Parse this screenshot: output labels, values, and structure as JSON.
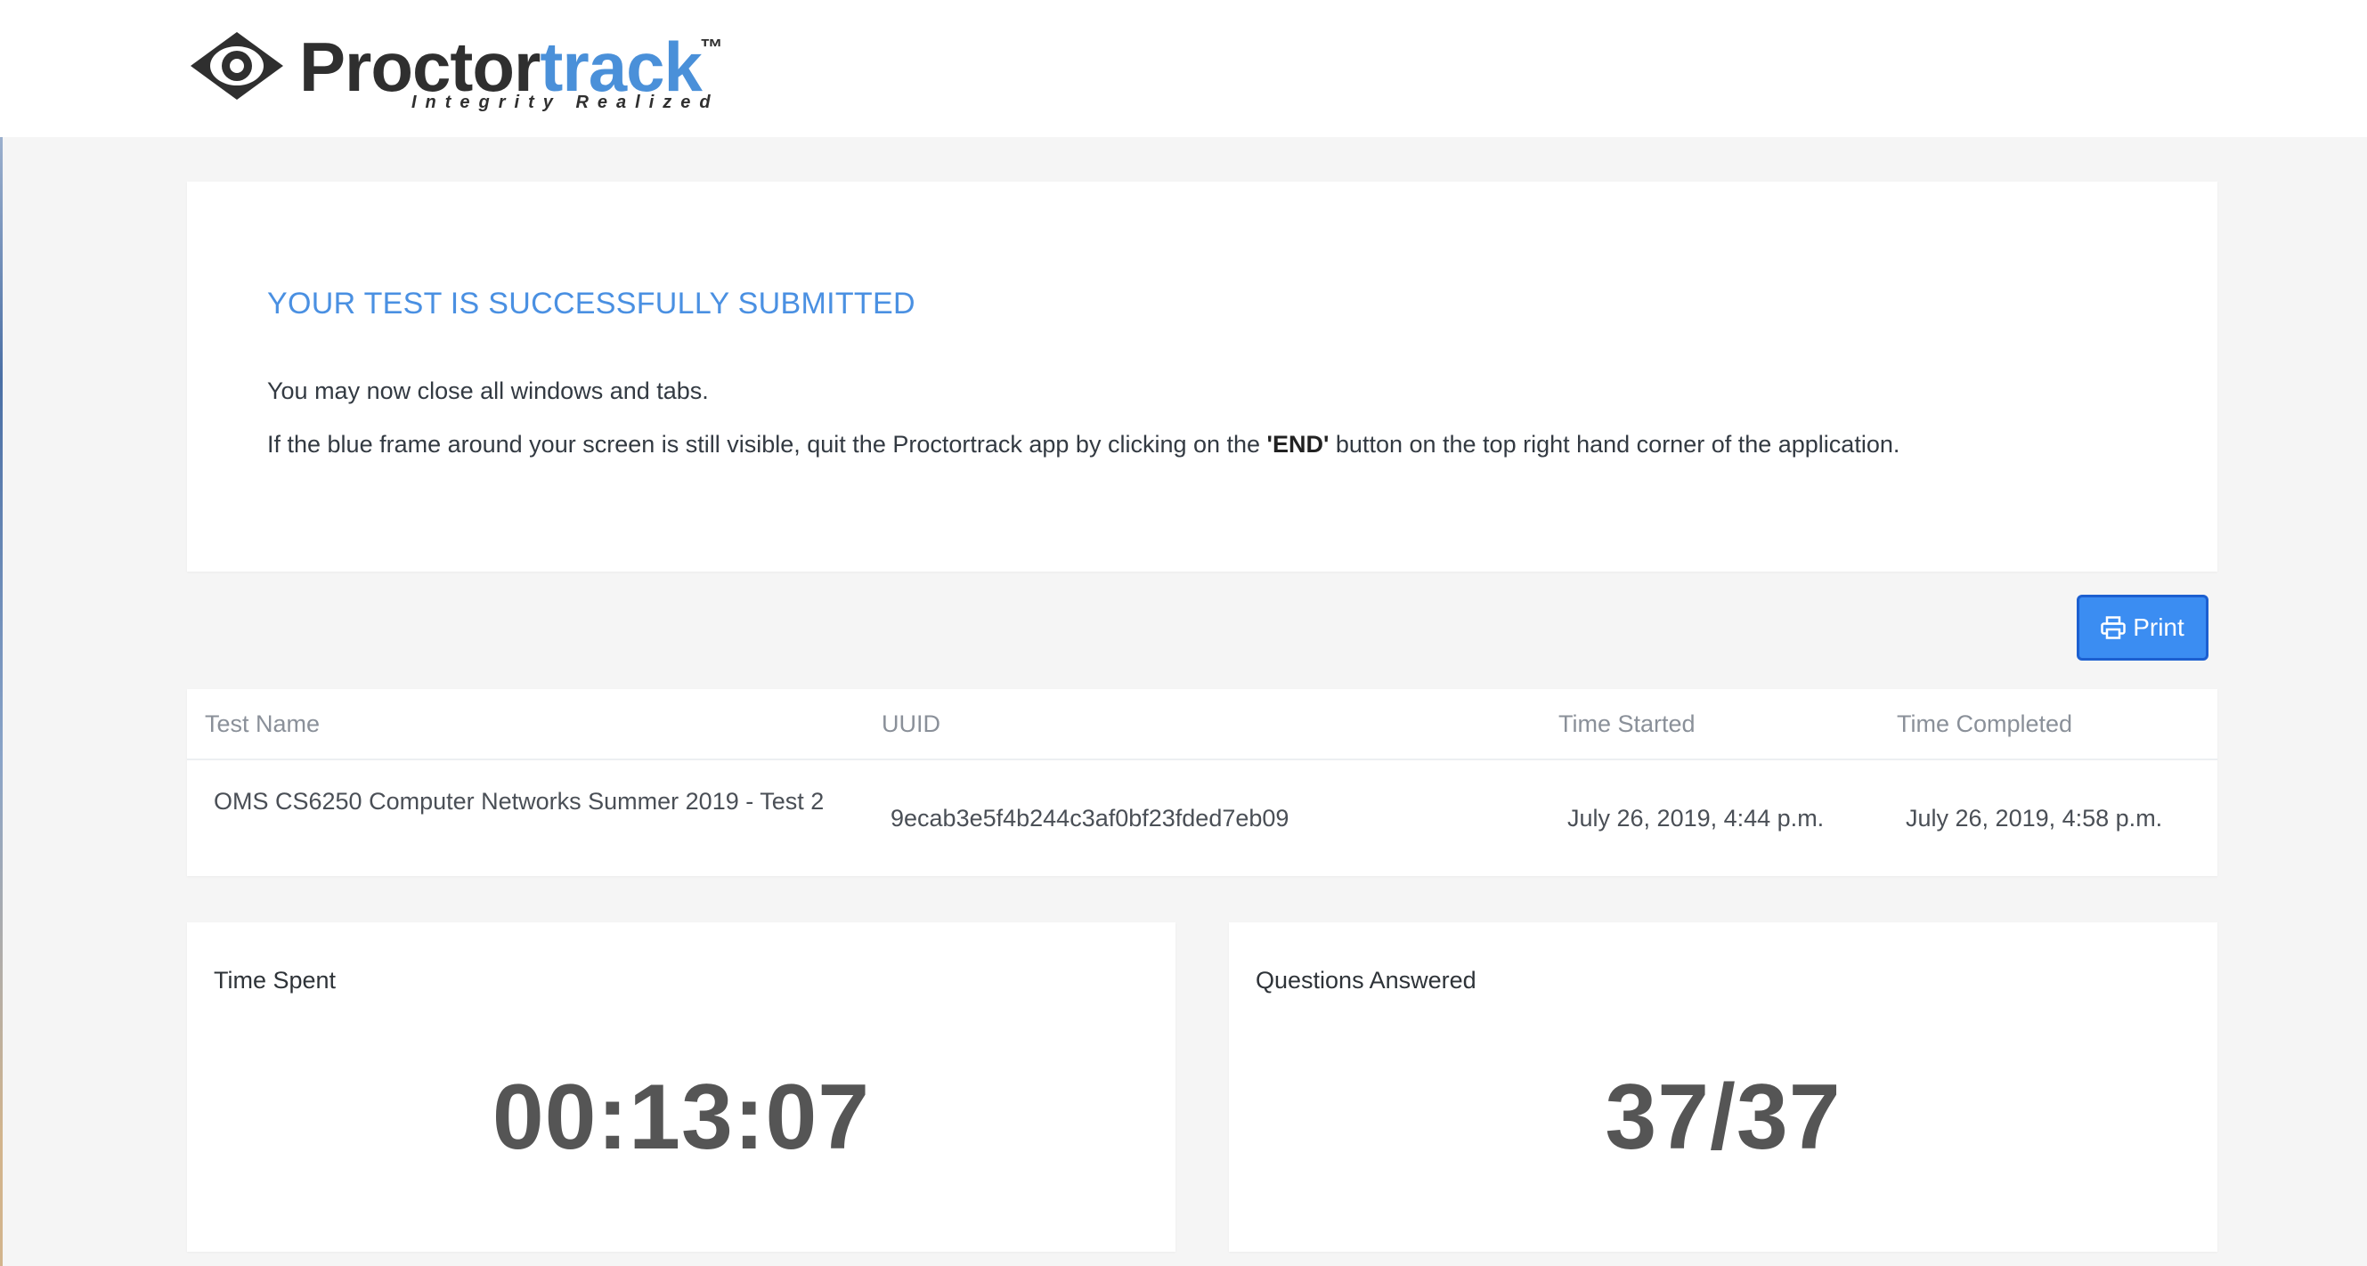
{
  "header": {
    "logo_name_dark": "Proctor",
    "logo_name_accent": "track",
    "logo_trademark": "™",
    "logo_tagline": "Integrity Realized"
  },
  "message": {
    "title": "YOUR TEST IS SUCCESSFULLY SUBMITTED",
    "line1": "You may now close all windows and tabs.",
    "line2_before": "If the blue frame around your screen is still visible, quit the Proctortrack app by clicking on the ",
    "line2_bold": "'END'",
    "line2_after": " button on the top right hand corner of the application."
  },
  "actions": {
    "print_label": "Print",
    "print_icon": "printer-icon"
  },
  "table": {
    "headers": {
      "test_name": "Test Name",
      "uuid": "UUID",
      "time_started": "Time Started",
      "time_completed": "Time Completed"
    },
    "row": {
      "test_name": "OMS CS6250 Computer Networks Summer 2019 - Test 2",
      "uuid": "9ecab3e5f4b244c3af0bf23fded7eb09",
      "time_started": "July 26, 2019, 4:44 p.m.",
      "time_completed": "July 26, 2019, 4:58 p.m."
    }
  },
  "stats": {
    "time_spent": {
      "label": "Time Spent",
      "value": "00:13:07"
    },
    "questions_answered": {
      "label": "Questions Answered",
      "value": "37/37"
    }
  },
  "colors": {
    "accent": "#4a90e2",
    "button": "#3b8df2",
    "background": "#f5f5f5"
  }
}
